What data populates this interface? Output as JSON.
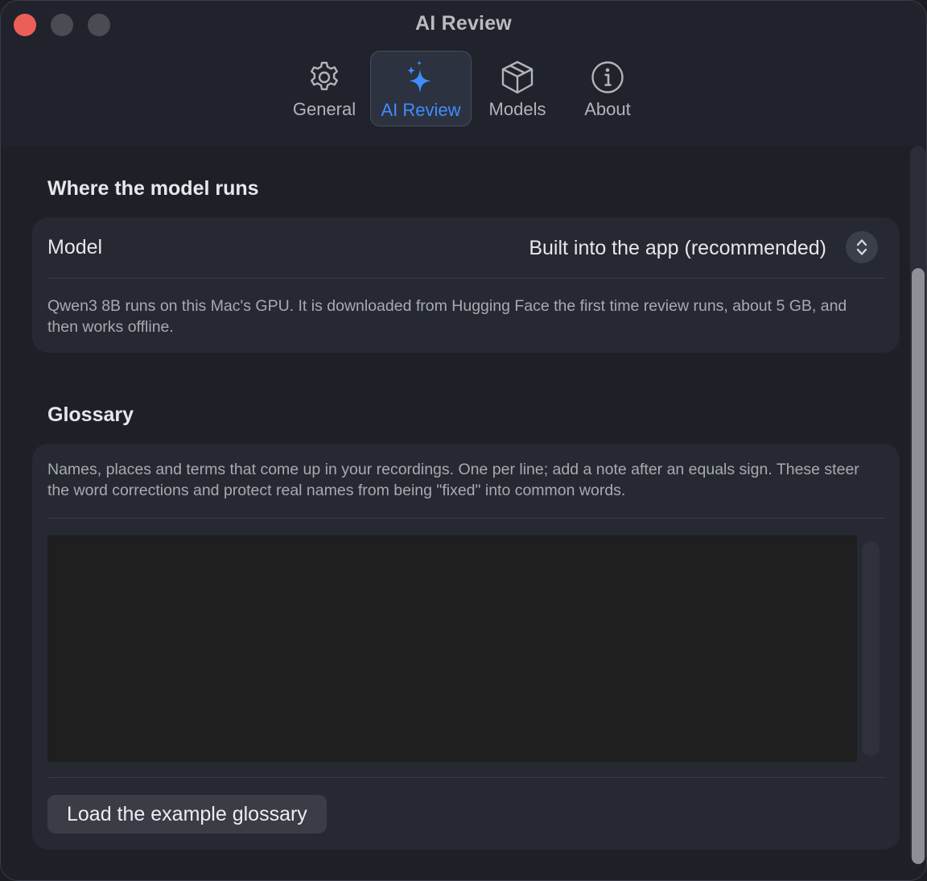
{
  "window": {
    "title": "AI Review"
  },
  "tabs": [
    {
      "label": "General",
      "icon": "gear-icon",
      "active": false
    },
    {
      "label": "AI Review",
      "icon": "sparkles-icon",
      "active": true
    },
    {
      "label": "Models",
      "icon": "cube-icon",
      "active": false
    },
    {
      "label": "About",
      "icon": "info-icon",
      "active": false
    }
  ],
  "model_section": {
    "title": "Where the model runs",
    "model_label": "Model",
    "model_value": "Built into the app (recommended)",
    "description": "Qwen3 8B runs on this Mac's GPU. It is downloaded from Hugging Face the first time review runs, about 5 GB, and then works offline."
  },
  "glossary_section": {
    "title": "Glossary",
    "description": "Names, places and terms that come up in your recordings. One per line; add a note after an equals sign. These steer the word corrections and protect real names from being \"fixed\" into common words.",
    "text_value": "",
    "load_button_label": "Load the example glossary"
  },
  "colors": {
    "accent": "#3f8dff",
    "close": "#ec5f57",
    "window_bg": "#20232b",
    "card_bg": "#262932"
  }
}
